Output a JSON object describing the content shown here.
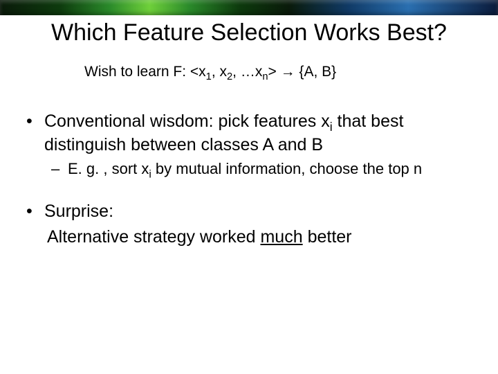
{
  "title": "Which Feature Selection Works Best?",
  "subtitle_parts": {
    "prefix": "Wish to learn F:  <x",
    "s1": "1",
    "mid1": ", x",
    "s2": "2",
    "mid2": ", …x",
    "sn": "n",
    "suffix": "> → {A, B}"
  },
  "bullets": {
    "b1_pre": "Conventional wisdom: pick features x",
    "b1_sub": "i",
    "b1_post": " that best distinguish between classes A and B",
    "b1a_pre": "E. g. , sort x",
    "b1a_sub": "i",
    "b1a_post": " by mutual information, choose the top n",
    "b2": "Surprise:",
    "b2_cont_pre": "Alternative strategy worked ",
    "b2_cont_u": "much",
    "b2_cont_post": " better"
  }
}
